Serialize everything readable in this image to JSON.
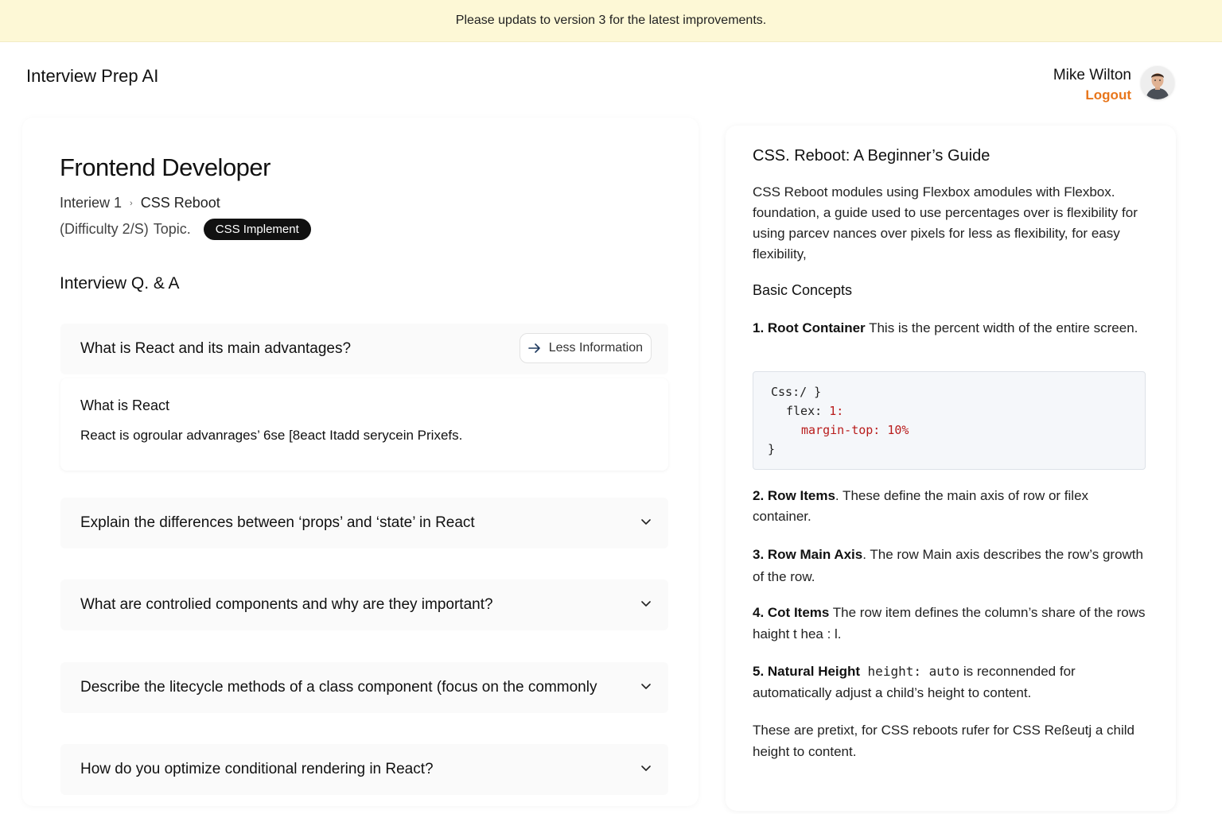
{
  "banner": {
    "text": "Please updats to version 3 for the latest improvements."
  },
  "header": {
    "brand": "Interview Prep AI",
    "user_name": "Mike Wilton",
    "logout_label": "Logout"
  },
  "job": {
    "title": "Frontend Developer",
    "breadcrumb": [
      "Interiew 1",
      "CSS Reboot"
    ],
    "difficulty": "(Difficulty 2/S)",
    "topic_label": "Topic.",
    "topic_pill": "CSS Implement"
  },
  "qa": {
    "section_title": "Interview Q. & A",
    "less_info_label": "Less Information",
    "questions": [
      "What is React and its main advantages?",
      "Explain the differences between ‘props’ and ‘state’ in React",
      "What are controlied components and why are they important?",
      "Describe the litecycle methods of a class component (focus on the commonly",
      "How do you optimize conditional rendering in React?"
    ],
    "expanded": {
      "title": "What is React",
      "body": "React is ogroular advanrages’ 6se [8eact Itadd serycein Prixefs."
    }
  },
  "guide": {
    "title": "CSS. Reboot: A Beginner’s Guide",
    "intro": "CSS Reboot modules using Flexbox amodules with Flexbox. foundation, a guide used to use percentages over is flexibility for using parcev nances over pixels for less as flexibility, for easy flexibility,",
    "basic_concepts": "Basic Concepts",
    "item1": {
      "head": "1. Root Container",
      "text": " This is the percent width of the entire screen."
    },
    "code": {
      "line1": "Css:/ }",
      "line2_key": "flex:",
      "line2_val": "1:",
      "line3_key": "margin-top:",
      "line3_val": "10%",
      "line4": "}"
    },
    "item2": {
      "head": "2. Row Items",
      "text": ". These define the main axis of row or filex container."
    },
    "item3": {
      "head": "3. Row Main Axis",
      "text": ". The row Main axis describes the row’s growth of the row."
    },
    "item4": {
      "head": "4. Cot Items",
      "text": " The row item defines the column’s share of the rows haight t hea : l."
    },
    "item5": {
      "head": "5. Natural Height",
      "code": "height: auto",
      "text": " is reconnended for automatically adjust a child’s height to content."
    },
    "closing": "These are pretixt, for CSS reboots rufer for CSS Reßeutj a child height to content."
  },
  "colors": {
    "banner_bg": "#fdf8d6",
    "logout": "#e8761b",
    "pill_bg": "#111111",
    "code_red": "#b91c1c"
  },
  "icons": {
    "arrow": "arrow-right-icon",
    "chevron": "chevron-down-icon",
    "avatar": "avatar"
  }
}
